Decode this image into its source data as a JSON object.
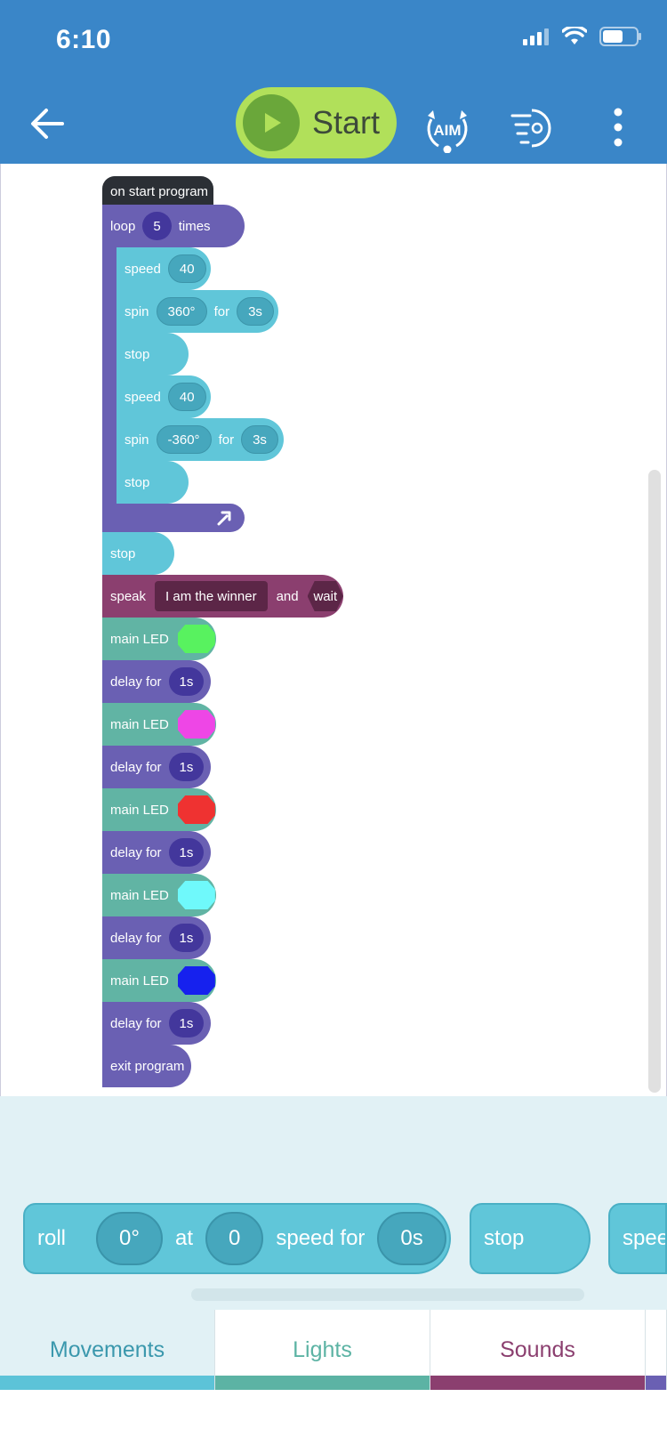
{
  "status_bar": {
    "time": "6:10"
  },
  "toolbar": {
    "start_label": "Start",
    "aim_label": "AIM"
  },
  "program": {
    "start": "on start program",
    "loop": {
      "label": "loop",
      "count": "5",
      "suffix": "times"
    },
    "loop_body": [
      {
        "type": "speed",
        "label": "speed",
        "value": "40"
      },
      {
        "type": "spin",
        "label": "spin",
        "angle": "360°",
        "for": "for",
        "duration": "3s"
      },
      {
        "type": "stop",
        "label": "stop"
      },
      {
        "type": "speed",
        "label": "speed",
        "value": "40"
      },
      {
        "type": "spin",
        "label": "spin",
        "angle": "-360°",
        "for": "for",
        "duration": "3s"
      },
      {
        "type": "stop",
        "label": "stop"
      }
    ],
    "after_loop_stop": "stop",
    "speak": {
      "label": "speak",
      "text": "I am the winner",
      "and": "and",
      "wait": "wait"
    },
    "sequence": [
      {
        "type": "led",
        "label": "main LED",
        "color": "#58f25f"
      },
      {
        "type": "delay",
        "label": "delay for",
        "value": "1s"
      },
      {
        "type": "led",
        "label": "main LED",
        "color": "#ee46e6"
      },
      {
        "type": "delay",
        "label": "delay for",
        "value": "1s"
      },
      {
        "type": "led",
        "label": "main LED",
        "color": "#ef3231"
      },
      {
        "type": "delay",
        "label": "delay for",
        "value": "1s"
      },
      {
        "type": "led",
        "label": "main LED",
        "color": "#6ff9fb"
      },
      {
        "type": "delay",
        "label": "delay for",
        "value": "1s"
      },
      {
        "type": "led",
        "label": "main LED",
        "color": "#1621ee"
      },
      {
        "type": "delay",
        "label": "delay for",
        "value": "1s"
      }
    ],
    "exit": "exit program"
  },
  "palette": {
    "roll": {
      "label": "roll",
      "angle": "0°",
      "at": "at",
      "speed": "0",
      "speed_for": "speed for",
      "duration": "0s"
    },
    "stop": "stop",
    "partial": "spee"
  },
  "tabs": [
    {
      "label": "Movements",
      "color": "#5cc3d8"
    },
    {
      "label": "Lights",
      "color": "#5cb3a4"
    },
    {
      "label": "Sounds",
      "color": "#8b3f6f"
    }
  ]
}
